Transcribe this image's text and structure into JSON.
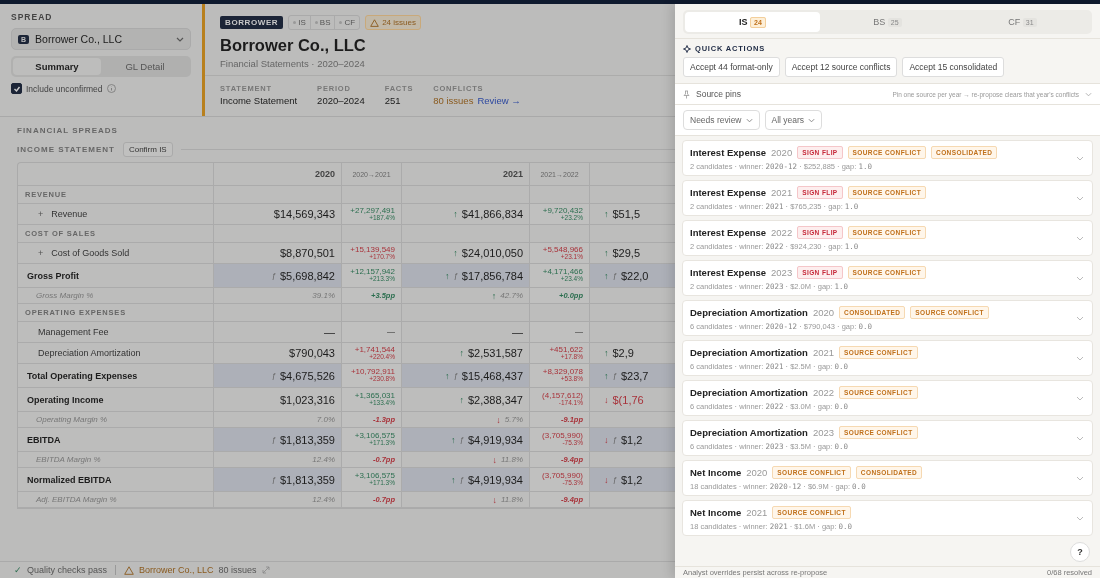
{
  "sidebar": {
    "label": "SPREAD",
    "entity": {
      "initial": "B",
      "name": "Borrower Co., LLC"
    },
    "view_tabs": [
      {
        "label": "Summary",
        "selected": true
      },
      {
        "label": "GL Detail",
        "selected": false
      }
    ],
    "include_unconfirmed": {
      "label": "Include unconfirmed",
      "checked": true
    }
  },
  "header": {
    "badge": "BORROWER",
    "statement_chips": [
      "IS",
      "BS",
      "CF"
    ],
    "issues_badge": "24 issues",
    "title": "Borrower Co., LLC",
    "subtitle": "Financial Statements · 2020–2024",
    "stats": [
      {
        "label": "STATEMENT",
        "value": "Income Statement"
      },
      {
        "label": "PERIOD",
        "value": "2020–2024"
      },
      {
        "label": "FACTS",
        "value": "251"
      }
    ],
    "conflicts": {
      "label": "CONFLICTS",
      "value": "80 issues",
      "link": "Review →"
    }
  },
  "section_title": "FINANCIAL SPREADS",
  "table_title": "INCOME STATEMENT",
  "confirm_button": "Confirm IS",
  "table": {
    "columns": [
      {
        "label": "2020",
        "kind": "year"
      },
      {
        "label": "2020→2021",
        "kind": "change"
      },
      {
        "label": "2021",
        "kind": "year"
      },
      {
        "label": "2021→2022",
        "kind": "change"
      }
    ],
    "rows": [
      {
        "kind": "section",
        "label": "REVENUE"
      },
      {
        "kind": "line",
        "toggle": "+",
        "label": "Revenue",
        "cells": [
          {
            "amount": "$14,569,343"
          },
          {
            "amount": "+27,297,491",
            "pct": "+187.4%",
            "favorable": true
          },
          {
            "arrow": "↑",
            "amount": "$41,866,834",
            "favorable": true
          },
          {
            "amount": "+9,720,432",
            "pct": "+23.2%",
            "favorable": true
          },
          {
            "arrow": "↑",
            "amount": "$51,5",
            "favorable": true
          }
        ]
      },
      {
        "kind": "section",
        "label": "COST OF SALES"
      },
      {
        "kind": "line",
        "toggle": "+",
        "label": "Cost of Goods Sold",
        "cells": [
          {
            "amount": "$8,870,501"
          },
          {
            "amount": "+15,139,549",
            "pct": "+170.7%",
            "favorable": false
          },
          {
            "arrow": "↑",
            "amount": "$24,010,050",
            "favorable": true
          },
          {
            "amount": "+5,548,966",
            "pct": "+23.1%",
            "favorable": false
          },
          {
            "arrow": "↑",
            "amount": "$29,5",
            "favorable": true
          }
        ]
      },
      {
        "kind": "total",
        "highlight": true,
        "label": "Gross Profit",
        "cells": [
          {
            "mark": "ƒ",
            "amount": "$5,698,842"
          },
          {
            "amount": "+12,157,942",
            "pct": "+213.3%",
            "favorable": true
          },
          {
            "arrow": "↑",
            "mark": "ƒ",
            "amount": "$17,856,784",
            "favorable": true
          },
          {
            "amount": "+4,171,466",
            "pct": "+23.4%",
            "favorable": true
          },
          {
            "arrow": "↑",
            "mark": "ƒ",
            "amount": "$22,0",
            "favorable": true
          }
        ]
      },
      {
        "kind": "ratio",
        "label": "Gross Margin %",
        "cells": [
          {
            "amount": "39.1%"
          },
          {
            "amount": "+3.5pp",
            "favorable": true
          },
          {
            "arrow": "↑",
            "amount": "42.7%",
            "favorable": true
          },
          {
            "amount": "+0.0pp",
            "favorable": true
          }
        ]
      },
      {
        "kind": "section",
        "label": "OPERATING EXPENSES"
      },
      {
        "kind": "line",
        "label": "Management Fee",
        "cells": [
          {
            "amount": "—"
          },
          {
            "amount": "—"
          },
          {
            "amount": "—"
          },
          {
            "amount": "—"
          }
        ]
      },
      {
        "kind": "line",
        "label": "Depreciation Amortization",
        "cells": [
          {
            "amount": "$790,043"
          },
          {
            "amount": "+1,741,544",
            "pct": "+220.4%",
            "favorable": false
          },
          {
            "arrow": "↑",
            "amount": "$2,531,587",
            "favorable": true
          },
          {
            "amount": "+451,622",
            "pct": "+17.8%",
            "favorable": false
          },
          {
            "arrow": "↑",
            "amount": "$2,9",
            "favorable": true
          }
        ]
      },
      {
        "kind": "total",
        "highlight": true,
        "label": "Total Operating Expenses",
        "cells": [
          {
            "mark": "ƒ",
            "amount": "$4,675,526"
          },
          {
            "amount": "+10,792,911",
            "pct": "+230.8%",
            "favorable": false
          },
          {
            "arrow": "↑",
            "mark": "ƒ",
            "amount": "$15,468,437",
            "favorable": true
          },
          {
            "amount": "+8,329,078",
            "pct": "+53.8%",
            "favorable": false
          },
          {
            "arrow": "↑",
            "mark": "ƒ",
            "amount": "$23,7",
            "favorable": true
          }
        ]
      },
      {
        "kind": "total",
        "highlight": false,
        "label": "Operating Income",
        "cells": [
          {
            "amount": "$1,023,316"
          },
          {
            "amount": "+1,365,031",
            "pct": "+133.4%",
            "favorable": true
          },
          {
            "arrow": "↑",
            "amount": "$2,388,347",
            "favorable": true
          },
          {
            "amount": "(4,157,612)",
            "pct": "-174.1%",
            "favorable": false
          },
          {
            "arrow": "↓",
            "amount": "$(1,76",
            "favorable": false
          }
        ]
      },
      {
        "kind": "ratio",
        "label": "Operating Margin %",
        "cells": [
          {
            "amount": "7.0%"
          },
          {
            "amount": "-1.3pp",
            "favorable": false
          },
          {
            "arrow": "↓",
            "amount": "5.7%",
            "favorable": false
          },
          {
            "amount": "-9.1pp",
            "favorable": false
          }
        ]
      },
      {
        "kind": "total",
        "highlight": true,
        "label": "EBITDA",
        "cells": [
          {
            "mark": "ƒ",
            "amount": "$1,813,359"
          },
          {
            "amount": "+3,106,575",
            "pct": "+171.3%",
            "favorable": true
          },
          {
            "arrow": "↑",
            "mark": "ƒ",
            "amount": "$4,919,934",
            "favorable": true
          },
          {
            "amount": "(3,705,990)",
            "pct": "-75.3%",
            "favorable": false
          },
          {
            "arrow": "↓",
            "mark": "ƒ",
            "amount": "$1,2",
            "favorable": false
          }
        ]
      },
      {
        "kind": "ratio",
        "label": "EBITDA Margin %",
        "cells": [
          {
            "amount": "12.4%"
          },
          {
            "amount": "-0.7pp",
            "favorable": false
          },
          {
            "arrow": "↓",
            "amount": "11.8%",
            "favorable": false
          },
          {
            "amount": "-9.4pp",
            "favorable": false
          }
        ]
      },
      {
        "kind": "total",
        "highlight": true,
        "label": "Normalized EBITDA",
        "cells": [
          {
            "mark": "ƒ",
            "amount": "$1,813,359"
          },
          {
            "amount": "+3,106,575",
            "pct": "+171.3%",
            "favorable": true
          },
          {
            "arrow": "↑",
            "mark": "ƒ",
            "amount": "$4,919,934",
            "favorable": true
          },
          {
            "amount": "(3,705,990)",
            "pct": "-75.3%",
            "favorable": false
          },
          {
            "arrow": "↓",
            "mark": "ƒ",
            "amount": "$1,2",
            "favorable": false
          }
        ]
      },
      {
        "kind": "ratio",
        "label": "Adj. EBITDA Margin %",
        "cells": [
          {
            "amount": "12.4%"
          },
          {
            "amount": "-0.7pp",
            "favorable": false
          },
          {
            "arrow": "↓",
            "amount": "11.8%",
            "favorable": false
          },
          {
            "amount": "-9.4pp",
            "favorable": false
          }
        ]
      }
    ]
  },
  "status_bar": {
    "check_icon": "✓",
    "quality": "Quality checks pass",
    "entity": "Borrower Co., LLC",
    "issues": "80 issues"
  },
  "drawer": {
    "tabs": [
      {
        "label": "IS",
        "count": "24",
        "selected": true
      },
      {
        "label": "BS",
        "count": "25",
        "selected": false
      },
      {
        "label": "CF",
        "count": "31",
        "selected": false
      }
    ],
    "quick_actions_title": "QUICK ACTIONS",
    "quick_actions": [
      "Accept 44 format-only",
      "Accept 12 source conflicts",
      "Accept 15 consolidated"
    ],
    "source_pins": {
      "label": "Source pins",
      "hint": "Pin one source per year → re-propose clears that year's conflicts"
    },
    "filters": [
      "Needs review",
      "All years"
    ],
    "issues": [
      {
        "name": "Interest Expense",
        "year": "2020",
        "tags": [
          {
            "label": "SIGN FLIP",
            "kind": "sign_flip"
          },
          {
            "label": "SOURCE CONFLICT",
            "kind": "source_conflict"
          },
          {
            "label": "CONSOLIDATED",
            "kind": "consolidated"
          }
        ],
        "lead": "2 candidates · winner:",
        "winner": "2020-12",
        "mid": "· $252,885 · gap:",
        "gap": "1.0"
      },
      {
        "name": "Interest Expense",
        "year": "2021",
        "tags": [
          {
            "label": "SIGN FLIP",
            "kind": "sign_flip"
          },
          {
            "label": "SOURCE CONFLICT",
            "kind": "source_conflict"
          }
        ],
        "lead": "2 candidates · winner:",
        "winner": "2021",
        "mid": "· $765,235 · gap:",
        "gap": "1.0"
      },
      {
        "name": "Interest Expense",
        "year": "2022",
        "tags": [
          {
            "label": "SIGN FLIP",
            "kind": "sign_flip"
          },
          {
            "label": "SOURCE CONFLICT",
            "kind": "source_conflict"
          }
        ],
        "lead": "2 candidates · winner:",
        "winner": "2022",
        "mid": "· $924,230 · gap:",
        "gap": "1.0"
      },
      {
        "name": "Interest Expense",
        "year": "2023",
        "tags": [
          {
            "label": "SIGN FLIP",
            "kind": "sign_flip"
          },
          {
            "label": "SOURCE CONFLICT",
            "kind": "source_conflict"
          }
        ],
        "lead": "2 candidates · winner:",
        "winner": "2023",
        "mid": "· $2.0M · gap:",
        "gap": "1.0"
      },
      {
        "name": "Depreciation Amortization",
        "year": "2020",
        "tags": [
          {
            "label": "CONSOLIDATED",
            "kind": "consolidated"
          },
          {
            "label": "SOURCE CONFLICT",
            "kind": "source_conflict"
          }
        ],
        "lead": "6 candidates · winner:",
        "winner": "2020-12",
        "mid": "· $790,043 · gap:",
        "gap": "0.0"
      },
      {
        "name": "Depreciation Amortization",
        "year": "2021",
        "tags": [
          {
            "label": "SOURCE CONFLICT",
            "kind": "source_conflict"
          }
        ],
        "lead": "6 candidates · winner:",
        "winner": "2021",
        "mid": "· $2.5M · gap:",
        "gap": "0.0"
      },
      {
        "name": "Depreciation Amortization",
        "year": "2022",
        "tags": [
          {
            "label": "SOURCE CONFLICT",
            "kind": "source_conflict"
          }
        ],
        "lead": "6 candidates · winner:",
        "winner": "2022",
        "mid": "· $3.0M · gap:",
        "gap": "0.0"
      },
      {
        "name": "Depreciation Amortization",
        "year": "2023",
        "tags": [
          {
            "label": "SOURCE CONFLICT",
            "kind": "source_conflict"
          }
        ],
        "lead": "6 candidates · winner:",
        "winner": "2023",
        "mid": "· $3.5M · gap:",
        "gap": "0.0"
      },
      {
        "name": "Net Income",
        "year": "2020",
        "tags": [
          {
            "label": "SOURCE CONFLICT",
            "kind": "source_conflict"
          },
          {
            "label": "CONSOLIDATED",
            "kind": "consolidated"
          }
        ],
        "lead": "18 candidates · winner:",
        "winner": "2020-12",
        "mid": "· $6.9M · gap:",
        "gap": "0.0"
      },
      {
        "name": "Net Income",
        "year": "2021",
        "tags": [
          {
            "label": "SOURCE CONFLICT",
            "kind": "source_conflict"
          }
        ],
        "lead": "18 candidates · winner:",
        "winner": "2021",
        "mid": "· $1.6M · gap:",
        "gap": "0.0"
      }
    ],
    "help_button": "?",
    "footer_note": "Analyst overrides persist across re-propose",
    "resolved": "0/68 resolved"
  }
}
